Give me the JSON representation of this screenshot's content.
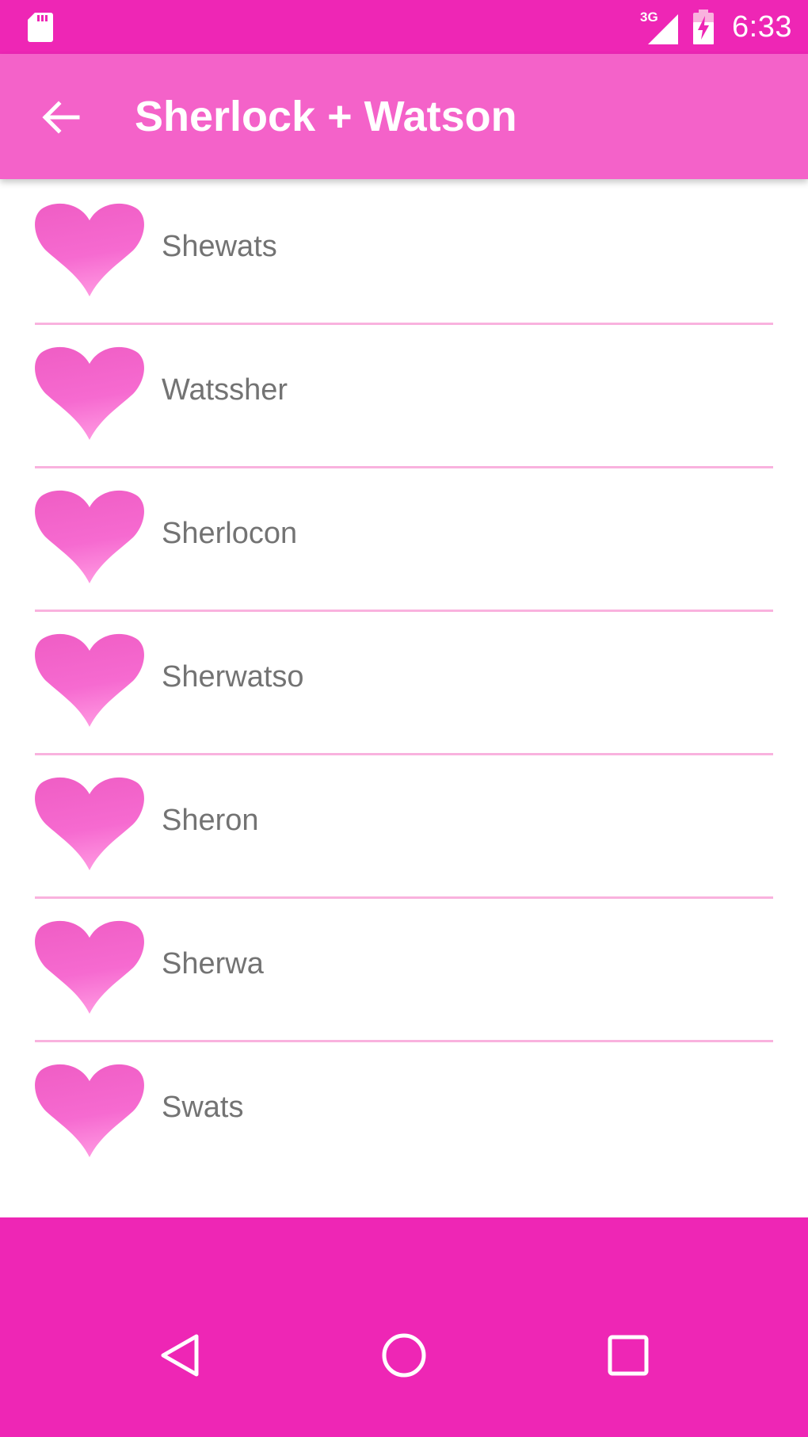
{
  "status_bar": {
    "network_label": "3G",
    "time": "6:33",
    "icons": [
      "sd-card-icon",
      "cell-signal-icon",
      "battery-charging-icon"
    ]
  },
  "app_bar": {
    "title": "Sherlock + Watson",
    "back_icon": "arrow-back-icon"
  },
  "list": {
    "items": [
      {
        "name": "Shewats"
      },
      {
        "name": "Watssher"
      },
      {
        "name": "Sherlocon"
      },
      {
        "name": "Sherwatso"
      },
      {
        "name": "Sheron"
      },
      {
        "name": "Sherwa"
      },
      {
        "name": "Swats"
      }
    ],
    "item_icon": "heart-icon"
  },
  "nav_bar": {
    "buttons": [
      "back-triangle-icon",
      "home-circle-icon",
      "recents-square-icon"
    ]
  },
  "colors": {
    "status_bar": "#ee26b5",
    "app_bar": "#f462c9",
    "divider": "#f9b2de",
    "text": "#737373",
    "bottom": "#ee26b5"
  }
}
